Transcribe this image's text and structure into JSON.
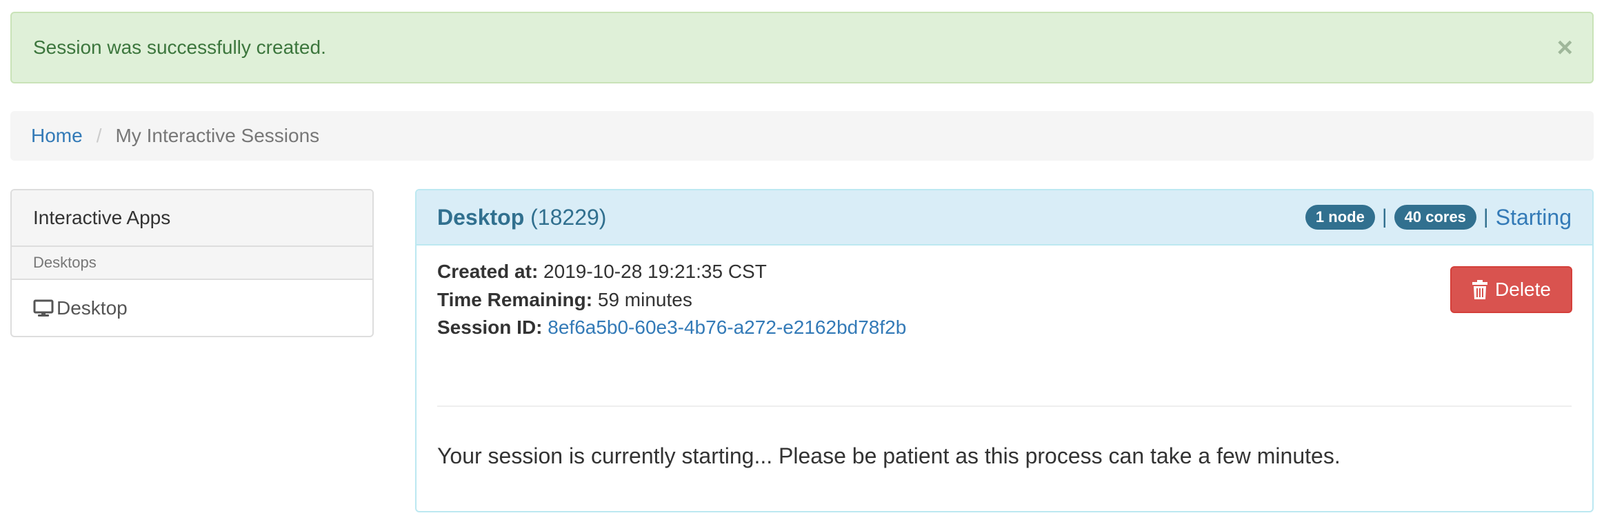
{
  "alert": {
    "message": "Session was successfully created.",
    "close_glyph": "×"
  },
  "breadcrumb": {
    "home": "Home",
    "separator": "/",
    "current": "My Interactive Sessions"
  },
  "sidebar": {
    "heading": "Interactive Apps",
    "groups": [
      {
        "label": "Desktops",
        "items": [
          {
            "label": "Desktop",
            "icon": "desktop-icon"
          }
        ]
      }
    ]
  },
  "session": {
    "app_name": "Desktop",
    "job_id": "(18229)",
    "nodes_badge": "1 node",
    "cores_badge": "40 cores",
    "separator": "|",
    "status": "Starting",
    "created_label": "Created at:",
    "created_value": "2019-10-28 19:21:35 CST",
    "time_label": "Time Remaining:",
    "time_value": "59 minutes",
    "id_label": "Session ID:",
    "id_value": "8ef6a5b0-60e3-4b76-a272-e2162bd78f2b",
    "delete_label": "Delete",
    "message": "Your session is currently starting... Please be patient as this process can take a few minutes."
  },
  "colors": {
    "alert_bg": "#dff0d8",
    "alert_text": "#3c763d",
    "link": "#337ab7",
    "panel_header_bg": "#d9edf7",
    "panel_header_text": "#31708f",
    "badge_bg": "#31708f",
    "delete_bg": "#d9534f"
  }
}
